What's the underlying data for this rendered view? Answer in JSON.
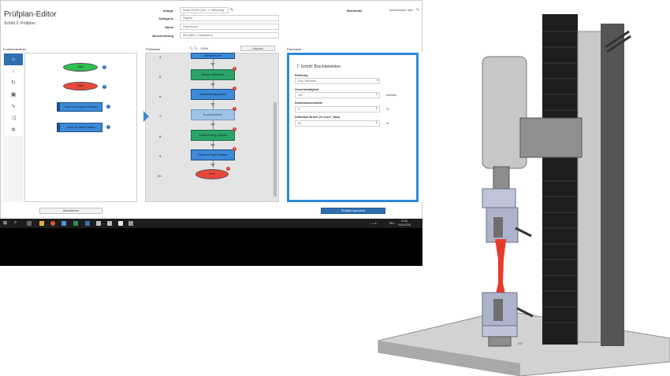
{
  "app": {
    "title": "Prüfplan-Editor",
    "subtitle": "Schritt 2: Prüfplan"
  },
  "form": {
    "anlage_label": "Anlage",
    "anlage_value": "Zwick ZHS02 (Ser. 1 / Werkzeug Testxpert)",
    "kategorie_label": "Kategorie",
    "kategorie_value": "Zugtest",
    "name_label": "Name",
    "name_value": "Zugversuch",
    "beschreibung_label": "Beschreibung",
    "beschreibung_value": "ISO 6892-1 Verfahren A",
    "bearbeiter_label": "Bearbeiter",
    "bearbeiter_value": "Administrator, Max"
  },
  "palette": {
    "label": "Funktionsblöcke",
    "icons": [
      "home-icon",
      "arrow-down-icon",
      "cycle-icon",
      "copy-icon",
      "pulse-icon",
      "shuffle-icon",
      "gear-icon"
    ],
    "blocks": [
      "Start",
      "Ende",
      "Fahre an Ereignis-Position",
      "Fahre an Start-Position"
    ],
    "button": "Aktualisieren"
  },
  "flow": {
    "label": "Prüfablauf",
    "zoom": "100%",
    "button": "Löschen",
    "steps": [
      {
        "num": "4.",
        "text": "Messen Kraft"
      },
      {
        "num": "5.",
        "text": "Sensor aktivieren"
      },
      {
        "num": "6.",
        "text": "Aufzeichnung starten"
      },
      {
        "num": "7.",
        "text": "Bruchdetektion"
      },
      {
        "num": "8.",
        "text": "Aufzeichnung stoppen"
      },
      {
        "num": "9.",
        "text": "Fahre an Start-Position"
      },
      {
        "num": "10.",
        "text": "Ende"
      }
    ]
  },
  "params": {
    "label": "Parameter",
    "heading": "7. Schritt: Bruchdetektion",
    "richtung_label": "Richtung",
    "richtung_value": "Zug / aufwärts",
    "geschw_label": "Geschwindigkeit",
    "geschw_value": "100",
    "geschw_unit": "mm/min",
    "detektion_label": "Detektionsschwelle",
    "detektion_value": "5",
    "detektion_unit": "%",
    "bruch_label": "Definition Bruch (% von F_Max)",
    "bruch_value": "50",
    "bruch_unit": "%",
    "save_button": "Prüfplan speichern"
  },
  "taskbar": {
    "lang": "DEU",
    "time": "10:16",
    "date": "15.06.2016"
  },
  "illustration": {
    "stamp": "C3"
  }
}
